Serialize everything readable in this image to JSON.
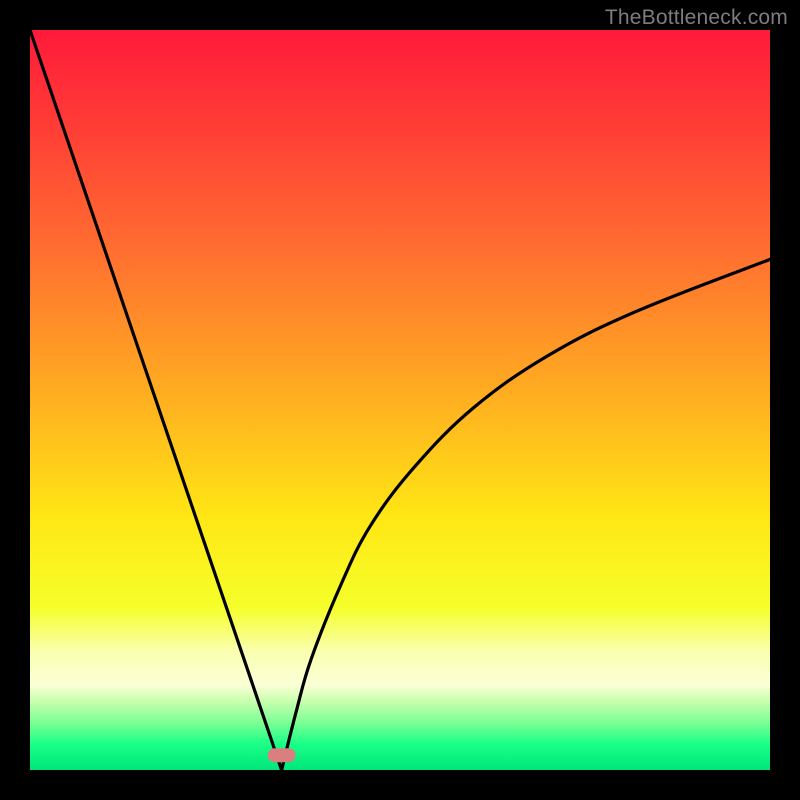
{
  "watermark": "TheBottleneck.com",
  "chart_data": {
    "type": "line",
    "title": "",
    "xlabel": "",
    "ylabel": "",
    "xlim": [
      0,
      100
    ],
    "ylim": [
      0,
      100
    ],
    "minimum_x": 34,
    "marker": {
      "x": 34,
      "y": 2,
      "color": "#d97f7f"
    },
    "gradient_stops": [
      {
        "offset": 0.0,
        "color": "#ff1a3a"
      },
      {
        "offset": 0.12,
        "color": "#ff3a36"
      },
      {
        "offset": 0.3,
        "color": "#ff6f30"
      },
      {
        "offset": 0.5,
        "color": "#ffb020"
      },
      {
        "offset": 0.66,
        "color": "#ffe714"
      },
      {
        "offset": 0.78,
        "color": "#f5ff2a"
      },
      {
        "offset": 0.84,
        "color": "#faffb0"
      },
      {
        "offset": 0.885,
        "color": "#fbffd6"
      },
      {
        "offset": 0.905,
        "color": "#cdffb0"
      },
      {
        "offset": 0.935,
        "color": "#7fff95"
      },
      {
        "offset": 0.965,
        "color": "#1aff88"
      },
      {
        "offset": 1.0,
        "color": "#00e67a"
      }
    ],
    "left_curve": {
      "x": [
        0,
        5,
        10,
        15,
        20,
        25,
        30,
        32,
        34
      ],
      "y": [
        100,
        85.3,
        70.6,
        55.9,
        41.2,
        26.5,
        11.8,
        5.9,
        0
      ]
    },
    "right_curve": {
      "x": [
        34,
        36,
        38,
        42,
        46,
        52,
        60,
        70,
        82,
        100
      ],
      "y": [
        0,
        8,
        15,
        25,
        33,
        41,
        49,
        56,
        62,
        69
      ]
    }
  }
}
